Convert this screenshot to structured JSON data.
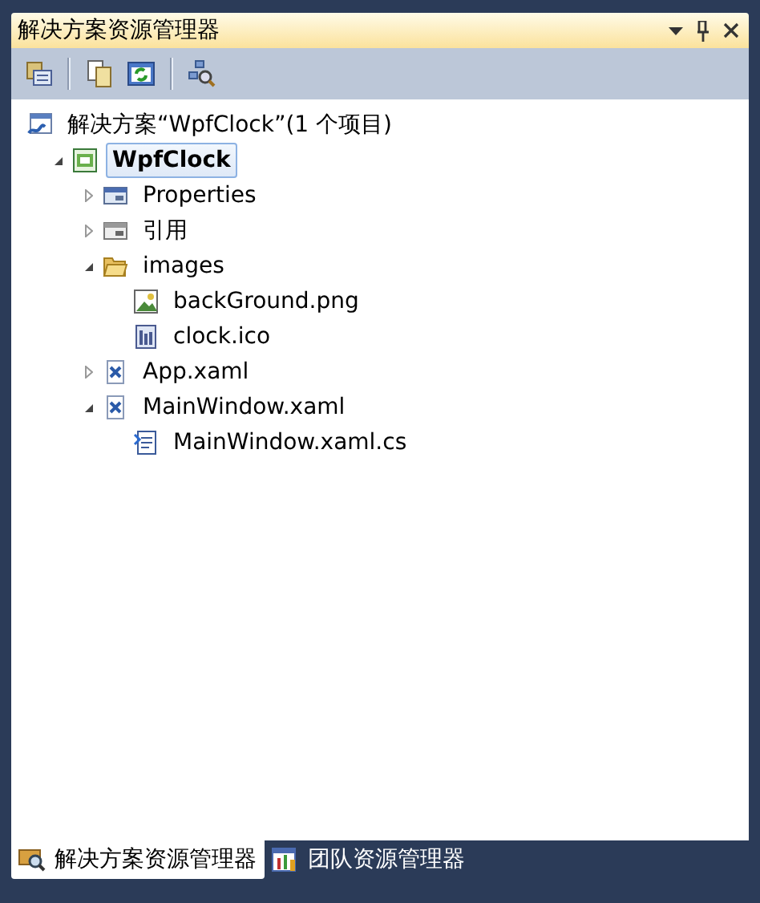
{
  "panel": {
    "title": "解决方案资源管理器"
  },
  "toolbar": {
    "items": [
      {
        "kind": "properties"
      },
      {
        "kind": "separator"
      },
      {
        "kind": "show-all"
      },
      {
        "kind": "refresh"
      },
      {
        "kind": "separator"
      },
      {
        "kind": "class-diagram"
      }
    ]
  },
  "tree": [
    {
      "label": "解决方案“WpfClock”(1 个项目)",
      "kind": "solution",
      "selected": false,
      "children": [
        {
          "label": "WpfClock",
          "kind": "project",
          "expanded": true,
          "selected": true,
          "children": [
            {
              "label": "Properties",
              "kind": "properties",
              "expanded": false,
              "selected": false
            },
            {
              "label": "引用",
              "kind": "references",
              "expanded": false,
              "selected": false
            },
            {
              "label": "images",
              "kind": "folder",
              "expanded": true,
              "selected": false,
              "children": [
                {
                  "label": "backGround.png",
                  "kind": "image",
                  "selected": false
                },
                {
                  "label": "clock.ico",
                  "kind": "icon-file",
                  "selected": false
                }
              ]
            },
            {
              "label": "App.xaml",
              "kind": "xaml",
              "expanded": false,
              "selected": false
            },
            {
              "label": "MainWindow.xaml",
              "kind": "xaml",
              "expanded": true,
              "selected": false,
              "children": [
                {
                  "label": "MainWindow.xaml.cs",
                  "kind": "cs",
                  "selected": false
                }
              ]
            }
          ]
        }
      ]
    }
  ],
  "tabs": [
    {
      "label": "解决方案资源管理器",
      "kind": "solution",
      "selected": true
    },
    {
      "label": "团队资源管理器",
      "kind": "team",
      "selected": false
    }
  ]
}
